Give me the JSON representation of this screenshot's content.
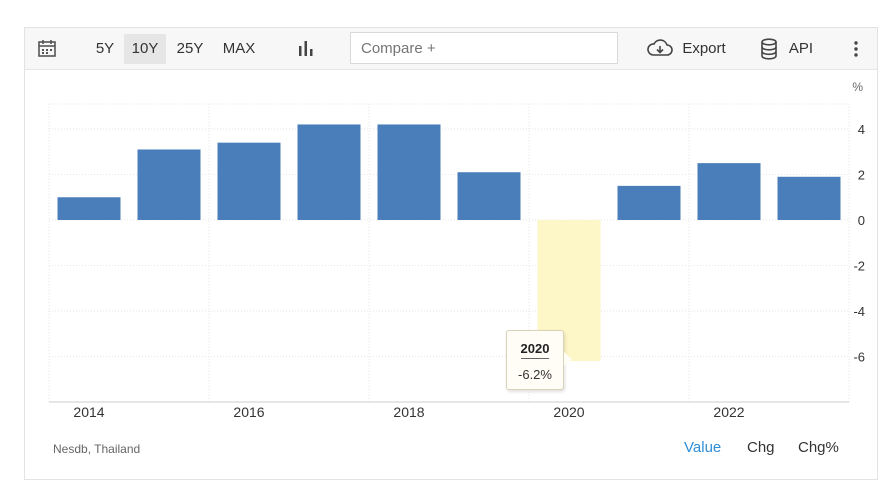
{
  "toolbar": {
    "ranges": [
      "5Y",
      "10Y",
      "25Y",
      "MAX"
    ],
    "active_range": "10Y",
    "compare_placeholder": "Compare +",
    "export_label": "Export",
    "api_label": "API",
    "icons": {
      "calendar": "calendar-icon",
      "chart_type": "bar-chart-icon",
      "export": "cloud-download-icon",
      "api": "database-icon",
      "more": "more-vertical-icon"
    }
  },
  "footer": {
    "source": "Nesdb, Thailand",
    "modes": [
      "Value",
      "Chg",
      "Chg%"
    ],
    "active_mode": "Value"
  },
  "tooltip": {
    "title": "2020",
    "value": "-6.2%"
  },
  "colors": {
    "bar": "#4a7ebb",
    "highlight": "#fdf6c6",
    "active_mode": "#2f8ed8",
    "grid": "#e6e6e6"
  },
  "chart_data": {
    "type": "bar",
    "unit": "%",
    "categories": [
      "2014",
      "2015",
      "2016",
      "2017",
      "2018",
      "2019",
      "2020",
      "2021",
      "2022",
      "2023"
    ],
    "values": [
      1.0,
      3.1,
      3.4,
      4.2,
      4.2,
      2.1,
      -6.2,
      1.5,
      2.5,
      1.9
    ],
    "x_tick_labels": [
      "2014",
      "2016",
      "2018",
      "2020",
      "2022"
    ],
    "y_tick_labels": [
      "4",
      "2",
      "0",
      "-2",
      "-4",
      "-6"
    ],
    "ylim": [
      -8,
      5
    ],
    "highlighted_category": "2020",
    "grid": true
  }
}
